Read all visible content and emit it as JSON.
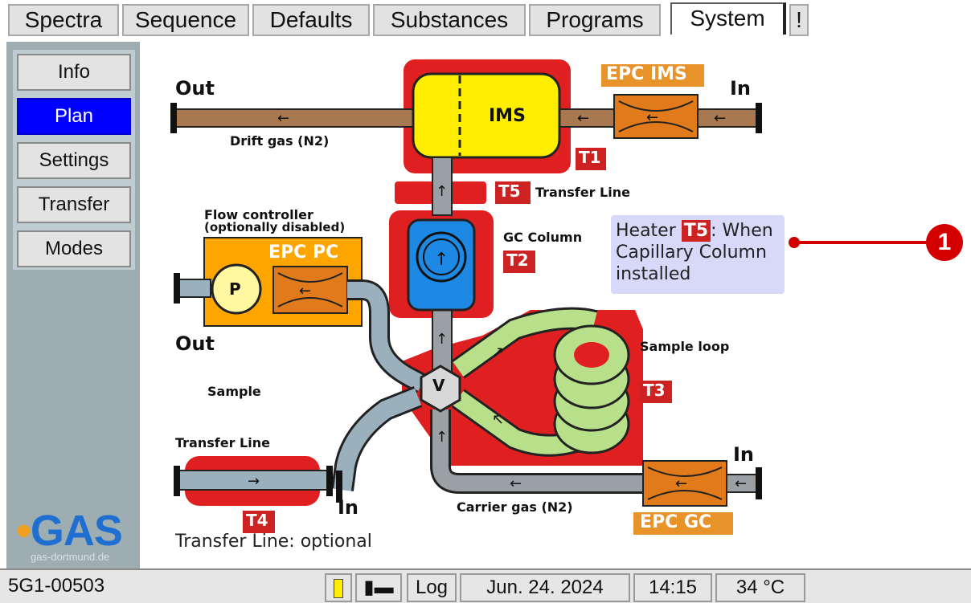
{
  "tabs": [
    {
      "label": "Spectra"
    },
    {
      "label": "Sequence"
    },
    {
      "label": "Defaults"
    },
    {
      "label": "Substances"
    },
    {
      "label": "Programs"
    },
    {
      "label": "System",
      "active": true
    },
    {
      "label": "!"
    }
  ],
  "sidebar": {
    "items": [
      {
        "label": "Info"
      },
      {
        "label": "Plan",
        "active": true
      },
      {
        "label": "Settings"
      },
      {
        "label": "Transfer"
      },
      {
        "label": "Modes"
      }
    ],
    "logo_text": "GAS",
    "logo_url": "gas-dortmund.de"
  },
  "diagram": {
    "out_top": "Out",
    "in_top": "In",
    "drift_gas": "Drift gas (N2)",
    "ims": "IMS",
    "epc_ims": "EPC IMS",
    "t1": "T1",
    "t5": "T5",
    "transfer_line_top": "Transfer Line",
    "flow_controller_1": "Flow controller",
    "flow_controller_2": "(optionally disabled)",
    "epc_pc": "EPC PC",
    "pump": "P",
    "gc_column": "GC Column",
    "t2": "T2",
    "out_mid": "Out",
    "sample_loop": "Sample loop",
    "valve": "V",
    "sample": "Sample",
    "t3": "T3",
    "transfer_line_left": "Transfer Line",
    "in_bottom_right": "In",
    "t4": "T4",
    "in_bottom_left": "In",
    "carrier_gas": "Carrier gas (N2)",
    "epc_gc": "EPC GC",
    "transfer_optional": "Transfer Line: optional"
  },
  "note": {
    "prefix": "Heater",
    "badge": "T5",
    "suffix": ": When Capillary Column installed"
  },
  "callout": {
    "number": "1"
  },
  "status": {
    "device_id": "5G1-00503",
    "log": "Log",
    "date": "Jun. 24. 2024",
    "time": "14:15",
    "temperature": "34 °C"
  },
  "colors": {
    "heater_red": "#e02020",
    "ims_yellow": "#ffee00",
    "epc_orange": "#e08020",
    "flow_orange": "#ffa500",
    "column_blue": "#1e88e5",
    "loop_green": "#b8e08a",
    "pipe_brown": "#a87850",
    "pipe_gray": "#9ab0bc",
    "active_blue": "#0000ff",
    "callout_red": "#d40000"
  }
}
